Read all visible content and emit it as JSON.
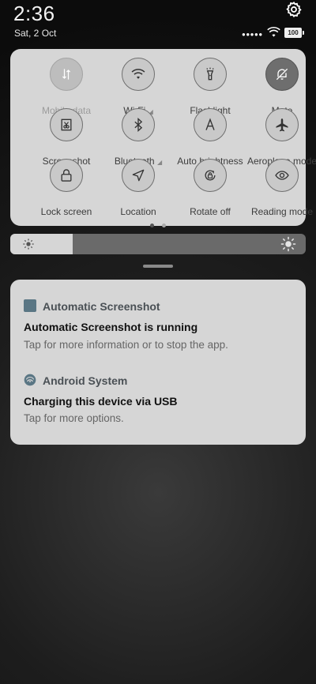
{
  "status_bar": {
    "time": "2:36",
    "date": "Sat, 2 Oct",
    "signal": "●●●●●",
    "battery": "100",
    "settings_icon": "gear-icon"
  },
  "quick_settings": {
    "tiles": [
      {
        "label": "Mobile data",
        "icon": "mobile-data-icon",
        "state": "off"
      },
      {
        "label": "Wi-Fi",
        "icon": "wifi-icon",
        "state": "normal"
      },
      {
        "label": "Flashlight",
        "icon": "flashlight-icon",
        "state": "normal"
      },
      {
        "label": "Mute",
        "icon": "mute-icon",
        "state": "on"
      },
      {
        "label": "Screenshot",
        "icon": "screenshot-icon",
        "state": "normal"
      },
      {
        "label": "Bluetooth",
        "icon": "bluetooth-icon",
        "state": "normal"
      },
      {
        "label": "Auto brightness",
        "icon": "auto-brightness-icon",
        "state": "normal"
      },
      {
        "label": "Aeroplane mode",
        "icon": "aeroplane-icon",
        "state": "normal"
      },
      {
        "label": "Lock screen",
        "icon": "lock-icon",
        "state": "normal"
      },
      {
        "label": "Location",
        "icon": "location-icon",
        "state": "normal"
      },
      {
        "label": "Rotate off",
        "icon": "rotate-icon",
        "state": "normal"
      },
      {
        "label": "Reading mode",
        "icon": "eye-icon",
        "state": "normal"
      }
    ],
    "page_index": 1,
    "page_count": 2
  },
  "brightness": {
    "level": 0.21
  },
  "notifications": [
    {
      "app": "Automatic Screenshot",
      "title": "Automatic Screenshot is running",
      "text": "Tap for more information or to stop the app.",
      "icon": "app-square-icon"
    },
    {
      "app": "Android System",
      "title": "Charging this device via USB",
      "text": "Tap for more options.",
      "icon": "android-system-icon"
    }
  ],
  "colors": {
    "panel": "#d6d6d6",
    "tile_border": "#6f6f6f",
    "active_tile": "#6e6e6e",
    "slider_track": "#6a6a6a",
    "app_icon": "#5a7684"
  }
}
